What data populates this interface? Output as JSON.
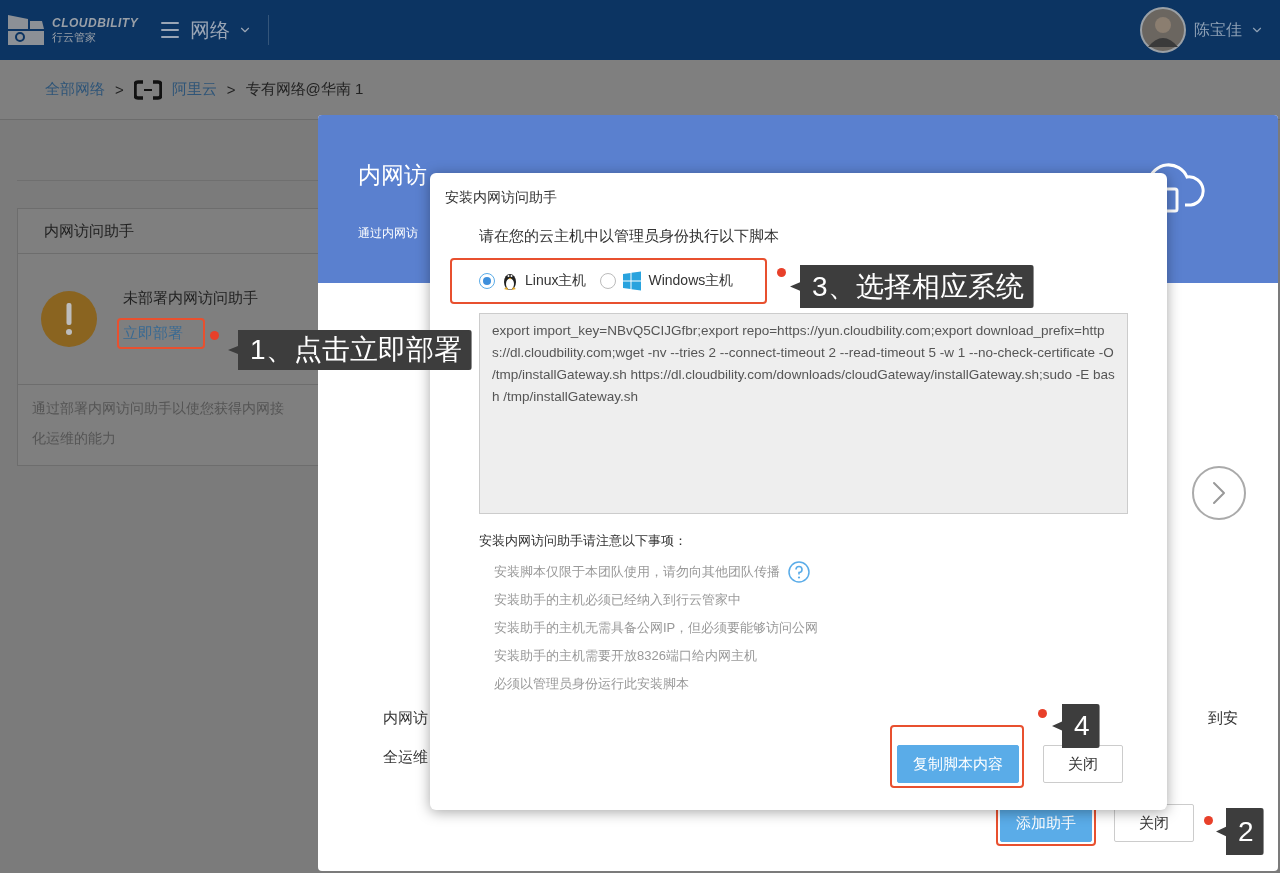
{
  "header": {
    "logo_text": "CLOUDBILITY",
    "logo_subtext": "行云管家",
    "menu_label": "网络",
    "user_name": "陈宝佳"
  },
  "breadcrumb": [
    {
      "label": "全部网络",
      "kind": "link"
    },
    {
      "label": ">",
      "kind": "separator"
    },
    {
      "label": "阿里云",
      "kind": "provider"
    },
    {
      "label": ">",
      "kind": "separator"
    },
    {
      "label": "专有网络@华南 1",
      "kind": "current"
    }
  ],
  "card": {
    "title": "内网访问助手",
    "status": "未部署内网访问助手",
    "action": {
      "label": "立即部署",
      "highlighted": true
    },
    "description_lines": [
      "通过部署内网访问助手以使您获得内网接",
      "化运维的能力"
    ],
    "callout": "1、点击立即部署"
  },
  "panel": {
    "title": "内网访",
    "subtitle": "通过内网访",
    "body_lines": [
      "内网访",
      "全运维"
    ],
    "body_right": "到安",
    "buttons": [
      {
        "label": "添加助手",
        "kind": "primary",
        "highlighted": true
      },
      {
        "label": "关闭",
        "kind": "default",
        "highlighted": false
      }
    ],
    "callout": "2"
  },
  "dialog": {
    "title": "安装内网访问助手",
    "instruction": "请在您的云主机中以管理员身份执行以下脚本",
    "os_options": [
      {
        "label": "Linux主机",
        "kind": "linux",
        "selected": true
      },
      {
        "label": "Windows主机",
        "kind": "windows",
        "selected": false
      }
    ],
    "os_highlighted": true,
    "os_callout": "3、选择相应系统",
    "script": "export import_key=NBvQ5CIJGfbr;export repo=https://yun.cloudbility.com;export download_prefix=https://dl.cloudbility.com;wget -nv --tries 2 --connect-timeout 2 --read-timeout 5 -w 1 --no-check-certificate -O /tmp/installGateway.sh https://dl.cloudbility.com/downloads/cloudGateway/installGateway.sh;sudo -E bash /tmp/installGateway.sh",
    "notes_title": "安装内网访问助手请注意以下事项：",
    "notes": [
      {
        "text": "安装脚本仅限于本团队使用，请勿向其他团队传播",
        "help": true
      },
      {
        "text": "安装助手的主机必须已经纳入到行云管家中",
        "help": false
      },
      {
        "text": "安装助手的主机无需具备公网IP，但必须要能够访问公网",
        "help": false
      },
      {
        "text": "安装助手的主机需要开放8326端口给内网主机",
        "help": false
      },
      {
        "text": "必须以管理员身份运行此安装脚本",
        "help": false
      }
    ],
    "buttons": [
      {
        "label": "复制脚本内容",
        "kind": "primary",
        "highlighted": true
      },
      {
        "label": "关闭",
        "kind": "default",
        "highlighted": false
      }
    ],
    "buttons_callout": "4"
  }
}
